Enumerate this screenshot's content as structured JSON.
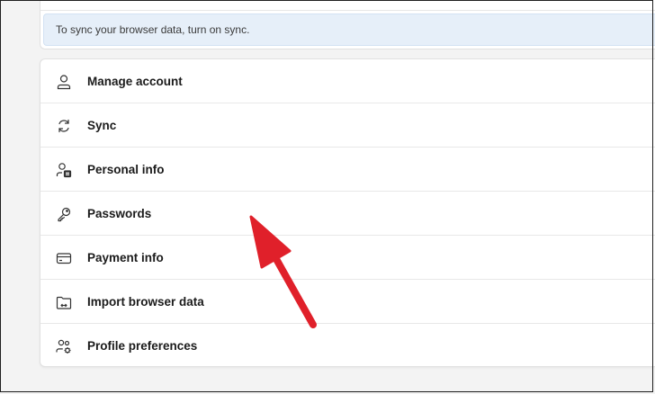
{
  "banner": {
    "text": "To sync your browser data, turn on sync."
  },
  "menu": {
    "items": [
      {
        "label": "Manage account",
        "icon": "person-icon"
      },
      {
        "label": "Sync",
        "icon": "sync-icon"
      },
      {
        "label": "Personal info",
        "icon": "personal-info-icon"
      },
      {
        "label": "Passwords",
        "icon": "key-icon"
      },
      {
        "label": "Payment info",
        "icon": "credit-card-icon"
      },
      {
        "label": "Import browser data",
        "icon": "import-folder-icon"
      },
      {
        "label": "Profile preferences",
        "icon": "profile-settings-icon"
      }
    ]
  },
  "annotation": {
    "color": "#e0202a",
    "target": "Passwords"
  }
}
